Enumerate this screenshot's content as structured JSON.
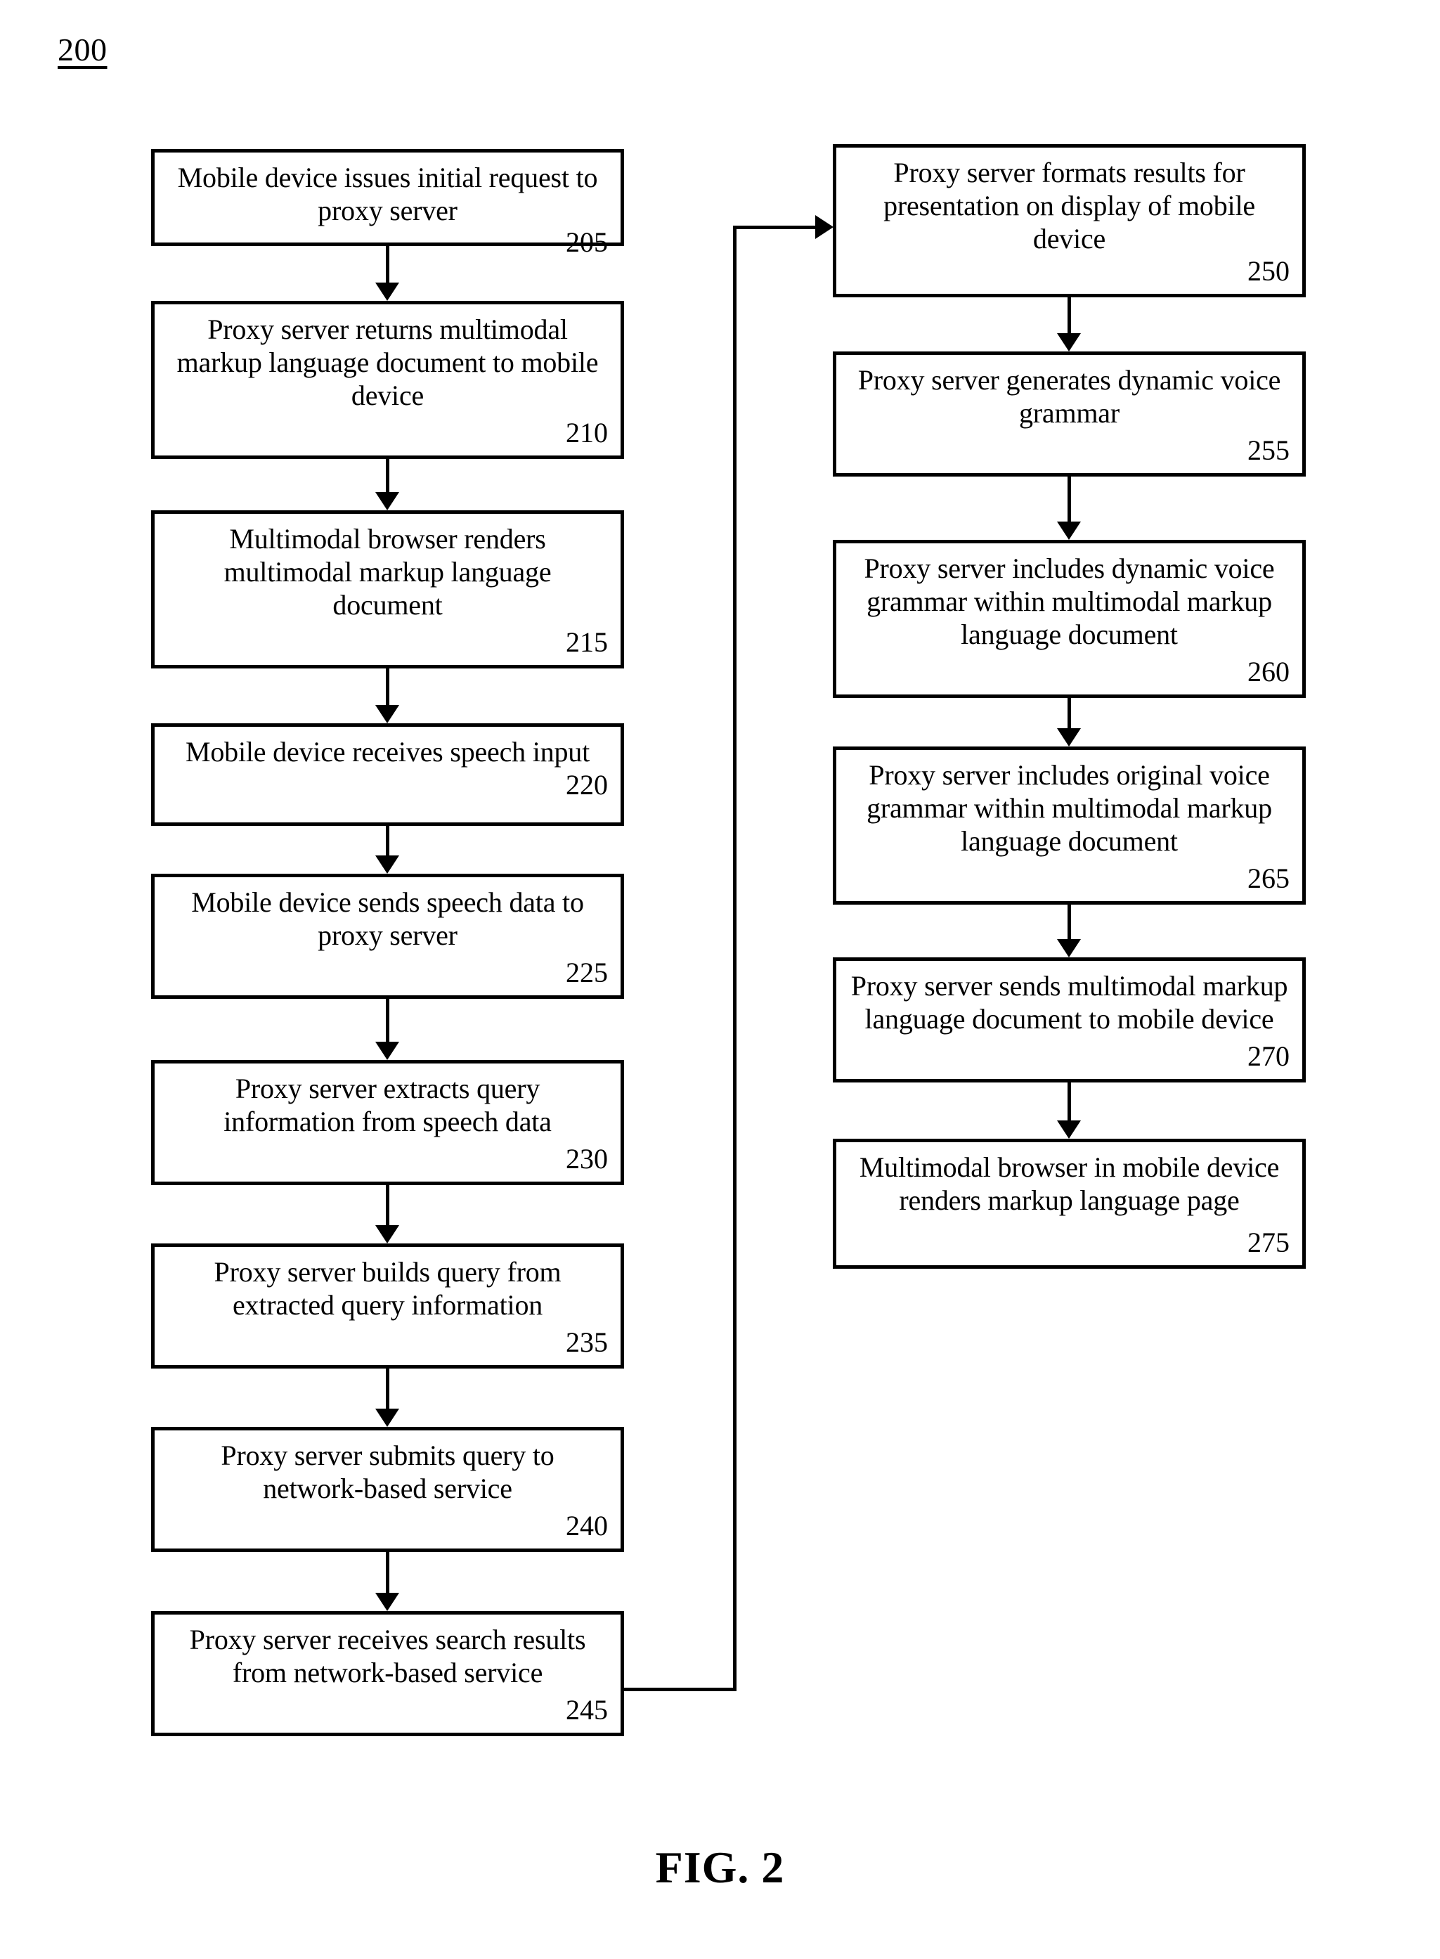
{
  "figure": {
    "reference_number": "200",
    "caption": "FIG. 2"
  },
  "left_column": [
    {
      "text": "Mobile device issues initial request to\nproxy server",
      "ref": "205"
    },
    {
      "text": "Proxy server returns multimodal\nmarkup language document to mobile\ndevice",
      "ref": "210"
    },
    {
      "text": "Multimodal browser renders\nmultimodal markup language\ndocument",
      "ref": "215"
    },
    {
      "text": "Mobile device receives speech input",
      "ref": "220"
    },
    {
      "text": "Mobile device sends speech data to\nproxy server",
      "ref": "225"
    },
    {
      "text": "Proxy server extracts query\ninformation from speech data",
      "ref": "230"
    },
    {
      "text": "Proxy server builds query from\nextracted query information",
      "ref": "235"
    },
    {
      "text": "Proxy server submits query to\nnetwork-based service",
      "ref": "240"
    },
    {
      "text": "Proxy server receives search results\nfrom network-based service",
      "ref": "245"
    }
  ],
  "right_column": [
    {
      "text": "Proxy server formats results for\npresentation on display of mobile\ndevice",
      "ref": "250"
    },
    {
      "text": "Proxy server generates dynamic voice\ngrammar",
      "ref": "255"
    },
    {
      "text": "Proxy server includes dynamic voice\ngrammar within multimodal markup\nlanguage document",
      "ref": "260"
    },
    {
      "text": "Proxy server includes original voice\ngrammar within multimodal markup\nlanguage document",
      "ref": "265"
    },
    {
      "text": "Proxy server sends multimodal markup\nlanguage document to mobile device",
      "ref": "270"
    },
    {
      "text": "Multimodal browser in mobile device\nrenders markup language page",
      "ref": "275"
    }
  ]
}
